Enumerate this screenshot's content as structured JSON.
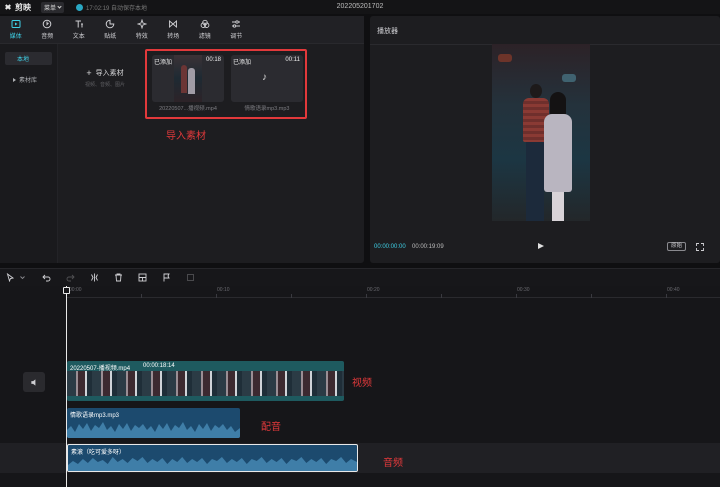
{
  "titlebar": {
    "app_name": "剪映",
    "menu_label": "菜单",
    "save_status": "17:02:19 自动保存本地",
    "project_name": "20220520170​2"
  },
  "toolbar": {
    "items": [
      {
        "label": "媒体",
        "icon": "media-icon",
        "active": true
      },
      {
        "label": "音频",
        "icon": "audio-icon"
      },
      {
        "label": "文本",
        "icon": "text-icon"
      },
      {
        "label": "贴纸",
        "icon": "sticker-icon"
      },
      {
        "label": "特效",
        "icon": "effects-icon"
      },
      {
        "label": "转场",
        "icon": "transition-icon"
      },
      {
        "label": "滤镜",
        "icon": "filter-icon"
      },
      {
        "label": "调节",
        "icon": "adjust-icon"
      }
    ]
  },
  "sidebar": {
    "items": [
      {
        "label": "本地"
      },
      {
        "label": "素材库"
      }
    ]
  },
  "import": {
    "label": "导入素材",
    "hint": "视频、音频、图片"
  },
  "assets": [
    {
      "tag": "已添加",
      "duration": "00:18",
      "name": "20220507...播视频.mp4"
    },
    {
      "tag": "已添加",
      "duration": "00:11",
      "name": "情歌语录mp3.mp3"
    }
  ],
  "annotations": {
    "import": "导入素材",
    "video": "视频",
    "voice": "配音",
    "music": "音频"
  },
  "player": {
    "title": "播放器",
    "current_time": "00:00:00:00",
    "total_time": "00:00:19:09",
    "original_label": "原始"
  },
  "timeline": {
    "ruler": [
      "00:00",
      "00:10",
      "00:20",
      "00:30",
      "00:40"
    ],
    "video_clip": {
      "name": "20220507-播视频.mp4",
      "duration": "00:00:18:14"
    },
    "voice_clip": {
      "name": "情歌语录mp3.mp3"
    },
    "music_clip": {
      "name": "素滚（吃可爱多呀）"
    }
  },
  "colors": {
    "accent": "#3fd0e6",
    "annotation": "#e2393b",
    "video_track": "#1e5a5f",
    "audio_track": "#1c4a6e"
  }
}
